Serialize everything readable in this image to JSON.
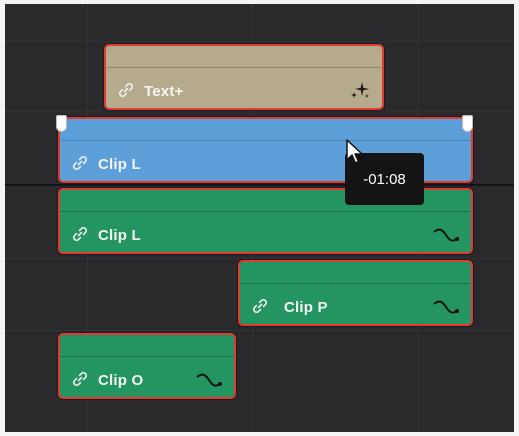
{
  "tooltip": {
    "delta": "-01:08"
  },
  "clips": {
    "text_plus": {
      "label": "Text+",
      "icon": "sparkle-icon"
    },
    "clip_l_video": {
      "label": "Clip L",
      "icon": "link-icon"
    },
    "clip_l_audio": {
      "label": "Clip L",
      "icon": "link-icon"
    },
    "clip_p": {
      "label": "Clip P",
      "icon": "link-icon"
    },
    "clip_o": {
      "label": "Clip O",
      "icon": "link-icon"
    }
  },
  "colors": {
    "background": "#2a2a2c",
    "selection_border": "#e23b34",
    "title_clip": "#b5aa8c",
    "video_clip": "#5c9fd9",
    "audio_clip": "#249461"
  }
}
